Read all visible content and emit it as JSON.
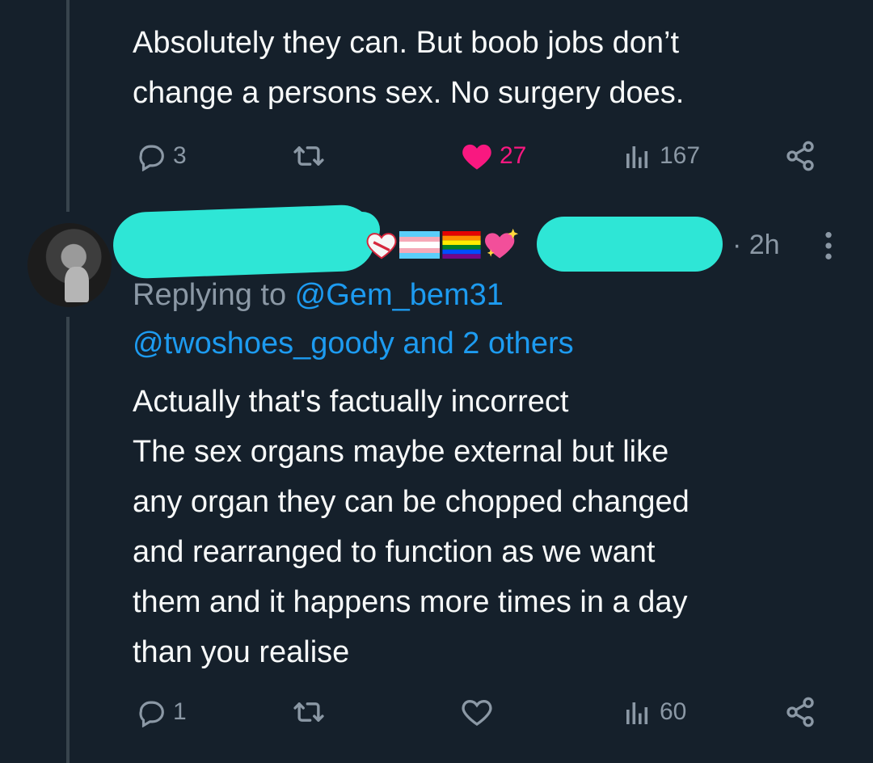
{
  "tweet1": {
    "text": "Absolutely they can. But boob jobs don’t\nchange a persons sex. No surgery does.",
    "replies": "3",
    "likes": "27",
    "views": "167"
  },
  "tweet2": {
    "time": "· 2h",
    "replying_prefix": "Replying to ",
    "replying_to": "@Gem_bem31",
    "mentions": "@twoshoes_goody and 2 others",
    "text": "Actually that's factually incorrect\nThe sex organs maybe external but like\nany organ they can be chopped changed\nand rearranged to function as we want\nthem and it happens more times in a day\nthan you realise",
    "replies": "1",
    "views": "60"
  },
  "colors": {
    "background": "#15202b",
    "text": "#f7f9f9",
    "secondary": "#8b98a5",
    "link": "#1d9bf0",
    "like": "#f91880",
    "redaction": "#2ee6d6"
  },
  "icons": [
    "reply-icon",
    "retweet-icon",
    "like-icon",
    "views-icon",
    "share-icon",
    "more-icon"
  ]
}
